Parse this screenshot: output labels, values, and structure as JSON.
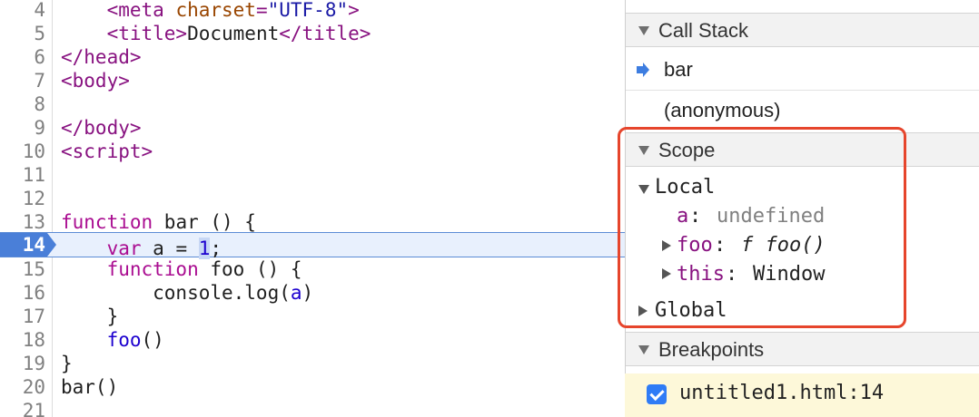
{
  "editor": {
    "lines": [
      {
        "num": "4",
        "tokens": [
          {
            "t": "    ",
            "c": ""
          },
          {
            "t": "<meta ",
            "c": "tag"
          },
          {
            "t": "charset",
            "c": "attr"
          },
          {
            "t": "=",
            "c": "tag"
          },
          {
            "t": "\"UTF-8\"",
            "c": "str"
          },
          {
            "t": ">",
            "c": "tag"
          }
        ]
      },
      {
        "num": "5",
        "tokens": [
          {
            "t": "    ",
            "c": ""
          },
          {
            "t": "<title>",
            "c": "tag"
          },
          {
            "t": "Document",
            "c": ""
          },
          {
            "t": "</title>",
            "c": "tag"
          }
        ]
      },
      {
        "num": "6",
        "tokens": [
          {
            "t": "</head>",
            "c": "tag"
          }
        ]
      },
      {
        "num": "7",
        "tokens": [
          {
            "t": "<body>",
            "c": "tag"
          }
        ]
      },
      {
        "num": "8",
        "tokens": []
      },
      {
        "num": "9",
        "tokens": [
          {
            "t": "</body>",
            "c": "tag"
          }
        ]
      },
      {
        "num": "10",
        "tokens": [
          {
            "t": "<script>",
            "c": "tag"
          }
        ]
      },
      {
        "num": "11",
        "tokens": []
      },
      {
        "num": "12",
        "tokens": []
      },
      {
        "num": "13",
        "tokens": [
          {
            "t": "function",
            "c": "kw"
          },
          {
            "t": " bar () {",
            "c": ""
          }
        ]
      },
      {
        "num": "14",
        "tokens": [
          {
            "t": "    ",
            "c": ""
          },
          {
            "t": "var",
            "c": "kw"
          },
          {
            "t": " a = ",
            "c": ""
          },
          {
            "t": "1",
            "c": "num sel-1"
          },
          {
            "t": ";",
            "c": ""
          }
        ]
      },
      {
        "num": "15",
        "tokens": [
          {
            "t": "    ",
            "c": ""
          },
          {
            "t": "function",
            "c": "kw"
          },
          {
            "t": " foo () {",
            "c": ""
          }
        ]
      },
      {
        "num": "16",
        "tokens": [
          {
            "t": "        console.log(",
            "c": ""
          },
          {
            "t": "a",
            "c": "var"
          },
          {
            "t": ")",
            "c": ""
          }
        ]
      },
      {
        "num": "17",
        "tokens": [
          {
            "t": "    }",
            "c": ""
          }
        ]
      },
      {
        "num": "18",
        "tokens": [
          {
            "t": "    ",
            "c": ""
          },
          {
            "t": "foo",
            "c": "var"
          },
          {
            "t": "()",
            "c": ""
          }
        ]
      },
      {
        "num": "19",
        "tokens": [
          {
            "t": "}",
            "c": ""
          }
        ]
      },
      {
        "num": "20",
        "tokens": [
          {
            "t": "bar()",
            "c": ""
          }
        ]
      },
      {
        "num": "21",
        "tokens": []
      }
    ],
    "active_line": "14"
  },
  "sidebar": {
    "call_stack": {
      "title": "Call Stack",
      "frames": [
        "bar",
        "(anonymous)"
      ]
    },
    "scope": {
      "title": "Scope",
      "local_label": "Local",
      "a_key": "a",
      "a_value": "undefined",
      "foo_key": "foo",
      "foo_value": "f foo()",
      "this_key": "this",
      "this_value": "Window",
      "global_label": "Global"
    },
    "breakpoints": {
      "title": "Breakpoints",
      "items": [
        "untitled1.html:14"
      ]
    }
  },
  "colors": {
    "highlight_box": "#e6452c",
    "execution_line": "#e8f0fd",
    "breakpoint_marker": "#4a7fd8"
  }
}
